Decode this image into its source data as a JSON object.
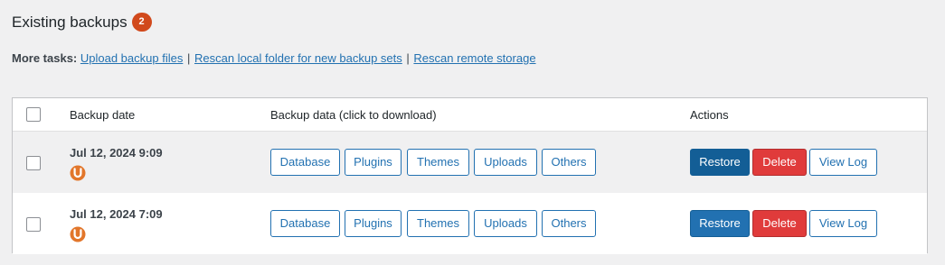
{
  "heading": {
    "title": "Existing backups",
    "count": "2"
  },
  "more_tasks": {
    "label": "More tasks:",
    "links": [
      "Upload backup files",
      "Rescan local folder for new backup sets",
      "Rescan remote storage"
    ],
    "separator": "|"
  },
  "table": {
    "headers": {
      "date": "Backup date",
      "data": "Backup data (click to download)",
      "actions": "Actions"
    },
    "rows": [
      {
        "date": "Jul 12, 2024 9:09",
        "icon": "updraft-u-icon",
        "data_buttons": [
          "Database",
          "Plugins",
          "Themes",
          "Uploads",
          "Others"
        ],
        "actions": {
          "restore": "Restore",
          "delete": "Delete",
          "view_log": "View Log"
        }
      },
      {
        "date": "Jul 12, 2024 7:09",
        "icon": "updraft-u-icon",
        "data_buttons": [
          "Database",
          "Plugins",
          "Themes",
          "Uploads",
          "Others"
        ],
        "actions": {
          "restore": "Restore",
          "delete": "Delete",
          "view_log": "View Log"
        }
      }
    ]
  },
  "colors": {
    "accent": "#2271b1",
    "badge": "#d1491c",
    "danger": "#e03b3b",
    "icon": "#e2762b"
  }
}
